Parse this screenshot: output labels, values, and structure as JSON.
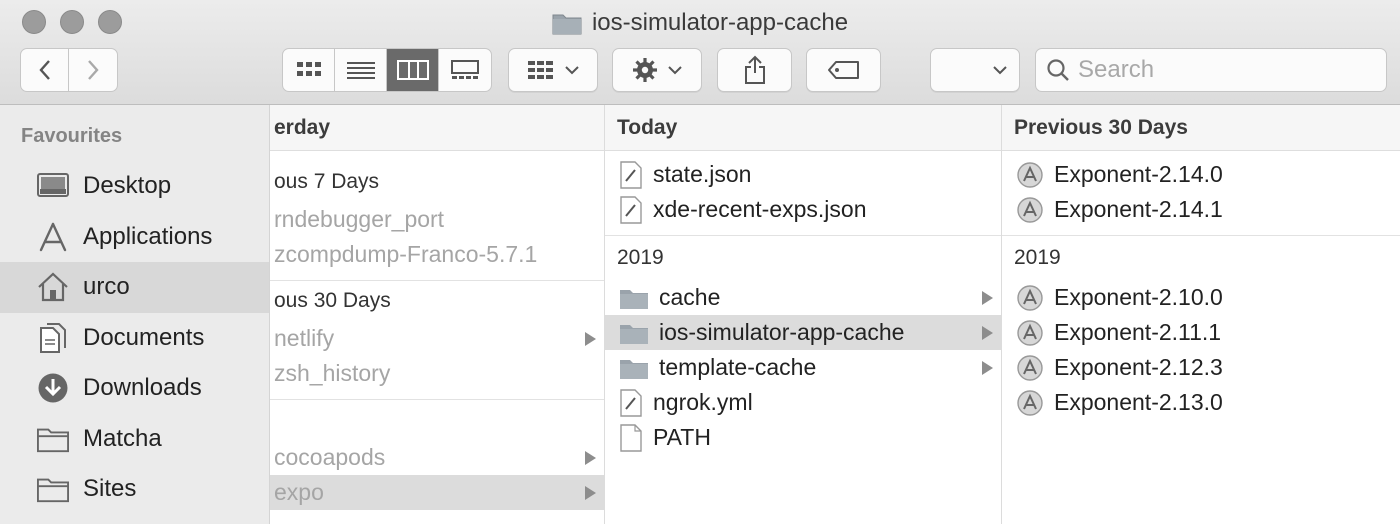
{
  "window": {
    "title": "ios-simulator-app-cache"
  },
  "toolbar": {
    "search_placeholder": "Search"
  },
  "sidebar": {
    "heading": "Favourites",
    "items": [
      {
        "label": "Desktop",
        "icon": "desktop-icon"
      },
      {
        "label": "Applications",
        "icon": "applications-icon"
      },
      {
        "label": "urco",
        "icon": "home-icon"
      },
      {
        "label": "Documents",
        "icon": "documents-icon"
      },
      {
        "label": "Downloads",
        "icon": "downloads-icon"
      },
      {
        "label": "Matcha",
        "icon": "folder-icon"
      },
      {
        "label": "Sites",
        "icon": "folder-icon"
      }
    ]
  },
  "columns": {
    "col1": {
      "header": "erday",
      "g1_label": "ous 7 Days",
      "g1_items": [
        "rndebugger_port",
        "zcompdump-Franco-5.7.1"
      ],
      "g2_label": "ous 30 Days",
      "g2_items": [
        "netlify",
        "zsh_history"
      ],
      "g3_items": [
        "cocoapods",
        "expo"
      ]
    },
    "col2": {
      "header": "Today",
      "today_items": [
        "state.json",
        "xde-recent-exps.json"
      ],
      "g2_label": "2019",
      "g2_items": [
        "cache",
        "ios-simulator-app-cache",
        "template-cache",
        "ngrok.yml",
        "PATH"
      ]
    },
    "col3": {
      "header": "Previous 30 Days",
      "items": [
        "Exponent-2.14.0",
        "Exponent-2.14.1"
      ],
      "g2_label": "2019",
      "g2_items": [
        "Exponent-2.10.0",
        "Exponent-2.11.1",
        "Exponent-2.12.3",
        "Exponent-2.13.0"
      ]
    }
  },
  "colors": {
    "selection": "#dcdcdc",
    "sidebar_bg": "#ebebeb",
    "active_view": "#6a6a6a",
    "folder": "#9aa3ab"
  }
}
